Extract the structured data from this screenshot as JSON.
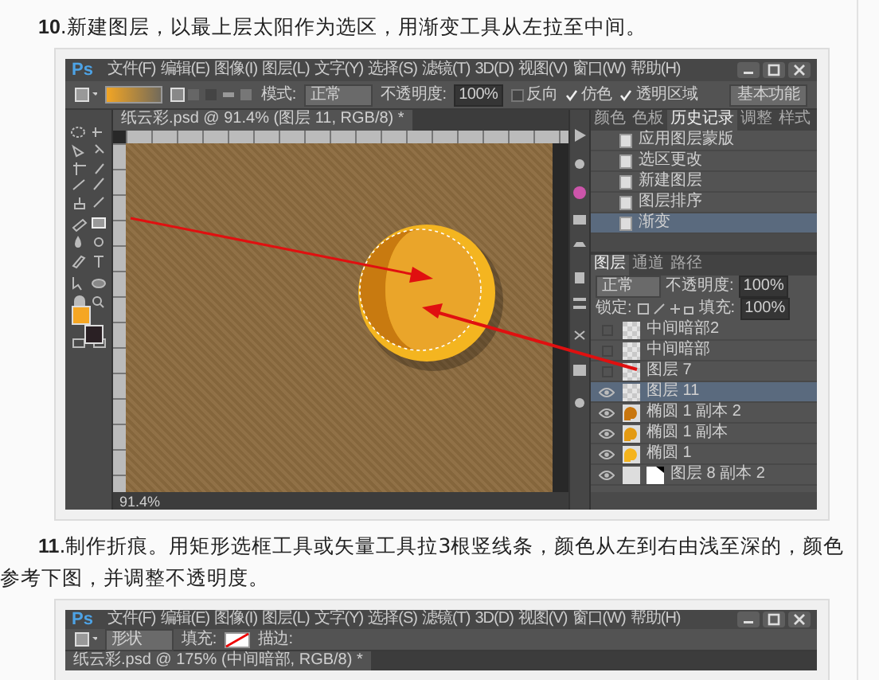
{
  "steps": [
    {
      "text": "**10**.新建图层，以最上层太阳作为选区，用渐变工具从左拉至中间。"
    },
    {
      "text": "**11**.制作折痕。用矩形选框工具或矢量工具拉3根竖线条，颜色从左到右由浅至深的，颜色参考下图，并调整不透明度。"
    }
  ],
  "figures": [
    {
      "logo": "Ps",
      "menu": [
        "文件(F)",
        "编辑(E)",
        "图像(I)",
        "图层(L)",
        "文字(Y)",
        "选择(S)",
        "滤镜(T)",
        "3D(D)",
        "视图(V)",
        "窗口(W)",
        "帮助(H)"
      ],
      "options": [
        {
          "kind": "gradient"
        },
        {
          "kind": "label",
          "text": "模式:"
        },
        {
          "kind": "dropdown",
          "text": "正常"
        },
        {
          "kind": "label",
          "text": "不透明度:"
        },
        {
          "kind": "field",
          "text": "100%"
        },
        {
          "kind": "checkbox",
          "text": "反向",
          "checked": false
        },
        {
          "kind": "checkbox",
          "text": "仿色",
          "checked": true
        },
        {
          "kind": "checkbox",
          "text": "透明区域",
          "checked": true
        }
      ],
      "workspace": "基本功能",
      "doc_tab": "纸云彩.psd @ 91.4% (图层 11, RGB/8) *",
      "zoom": "91.4%",
      "panel_tabs": [
        {
          "label": "颜色",
          "selected": false
        },
        {
          "label": "色板",
          "selected": false
        },
        {
          "label": "历史记录",
          "selected": true
        },
        {
          "label": "调整",
          "selected": false
        },
        {
          "label": "样式",
          "selected": false
        }
      ],
      "history": [
        {
          "label": "应用图层蒙版",
          "selected": false
        },
        {
          "label": "选区更改",
          "selected": false
        },
        {
          "label": "新建图层",
          "selected": false
        },
        {
          "label": "图层排序",
          "selected": false
        },
        {
          "label": "渐变",
          "selected": true
        }
      ],
      "layer_tabs": [
        {
          "label": "图层",
          "selected": true
        },
        {
          "label": "通道",
          "selected": false
        },
        {
          "label": "路径",
          "selected": false
        }
      ],
      "blend_mode": "正常",
      "opacity_label": "不透明度:",
      "opacity": "100%",
      "lock_label": "锁定:",
      "fill_label": "填充:",
      "fill": "100%",
      "layers": [
        {
          "name": "中间暗部2",
          "kind": "pixel",
          "visible": false,
          "selected": false
        },
        {
          "name": "中间暗部",
          "kind": "pixel",
          "visible": false,
          "selected": false
        },
        {
          "name": "图层 7",
          "kind": "pixel",
          "visible": false,
          "selected": false
        },
        {
          "name": "图层 11",
          "kind": "pixel",
          "visible": true,
          "selected": true
        },
        {
          "name": "椭圆 1 副本 2",
          "kind": "shape",
          "color": "#c8760e",
          "visible": true,
          "selected": false
        },
        {
          "name": "椭圆 1 副本",
          "kind": "shape",
          "color": "#e39a12",
          "visible": true,
          "selected": false
        },
        {
          "name": "椭圆 1",
          "kind": "shape",
          "color": "#f5b41c",
          "visible": true,
          "selected": false
        },
        {
          "name": "图层 8 副本 2",
          "kind": "masked",
          "visible": true,
          "selected": false
        }
      ]
    },
    {
      "logo": "Ps",
      "menu": [
        "文件(F)",
        "编辑(E)",
        "图像(I)",
        "图层(L)",
        "文字(Y)",
        "选择(S)",
        "滤镜(T)",
        "3D(D)",
        "视图(V)",
        "窗口(W)",
        "帮助(H)"
      ],
      "options": [
        {
          "kind": "dropdown",
          "text": "形状"
        },
        {
          "kind": "label",
          "text": "填充:"
        },
        {
          "kind": "swatch"
        },
        {
          "kind": "label",
          "text": "描边:"
        }
      ],
      "doc_tab": "纸云彩.psd @ 175% (中间暗部, RGB/8) *"
    }
  ]
}
